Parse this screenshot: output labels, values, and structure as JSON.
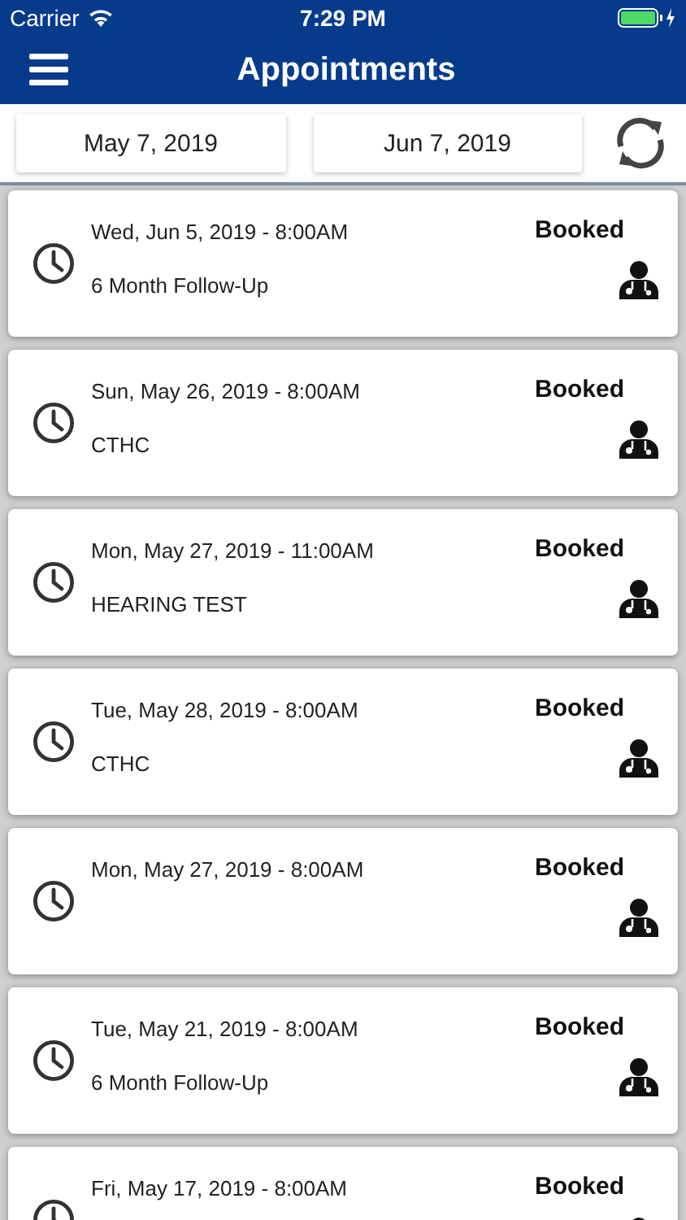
{
  "status_bar": {
    "carrier": "Carrier",
    "time": "7:29 PM"
  },
  "header": {
    "title": "Appointments"
  },
  "date_range": {
    "start": "May 7, 2019",
    "end": "Jun 7, 2019"
  },
  "appointments": [
    {
      "datetime": "Wed, Jun 5, 2019 - 8:00AM",
      "status": "Booked",
      "description": "6 Month Follow-Up"
    },
    {
      "datetime": "Sun, May 26, 2019 - 8:00AM",
      "status": "Booked",
      "description": "CTHC"
    },
    {
      "datetime": "Mon, May 27, 2019 - 11:00AM",
      "status": "Booked",
      "description": "HEARING TEST"
    },
    {
      "datetime": "Tue, May 28, 2019 - 8:00AM",
      "status": "Booked",
      "description": "CTHC"
    },
    {
      "datetime": "Mon, May 27, 2019 - 8:00AM",
      "status": "Booked"
    },
    {
      "datetime": "Tue, May 21, 2019 - 8:00AM",
      "status": "Booked",
      "description": "6 Month Follow-Up"
    },
    {
      "datetime": "Fri, May 17, 2019 - 8:00AM",
      "status": "Booked"
    }
  ]
}
